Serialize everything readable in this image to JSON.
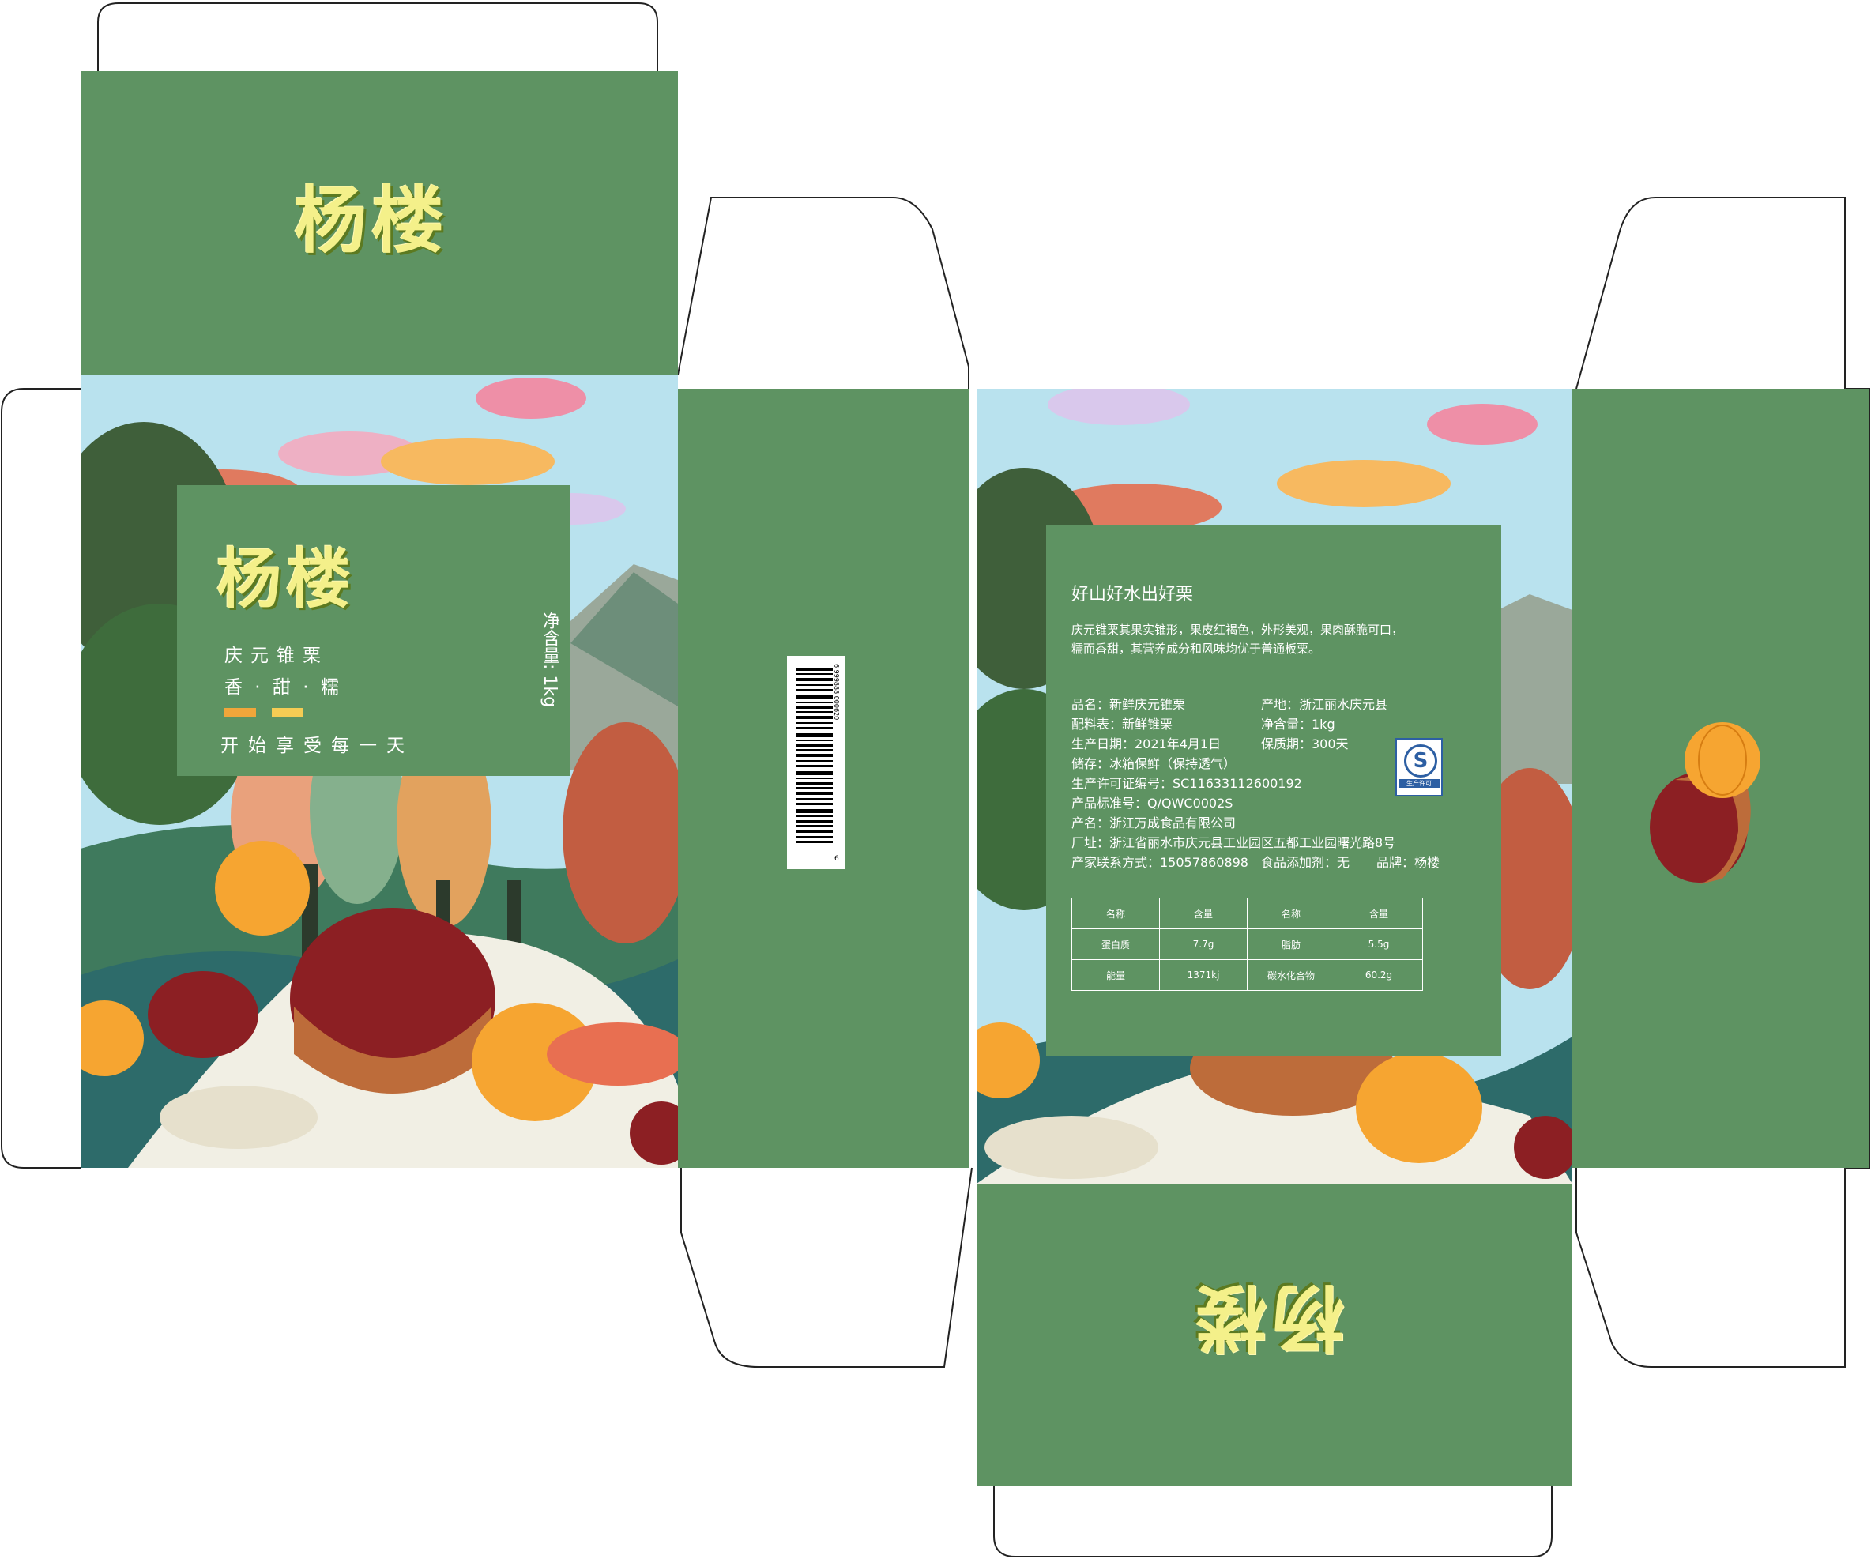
{
  "brand": {
    "name": "杨楼",
    "colors": {
      "panel_green": "#5e9362",
      "logo_yellow": "#f4f08a",
      "sky": "#b9e2ee"
    }
  },
  "front": {
    "product": "庆元锥栗",
    "taste": "香 · 甜 · 糯",
    "slogan": "开始享受每一天",
    "net_weight": "净含量: 1kg"
  },
  "side": {
    "barcode_number": "6 999888 000620",
    "barcode_digit": "6"
  },
  "back": {
    "headline": "好山好水出好栗",
    "description_line1": "庆元锥栗其果实锥形，果皮红褐色，外形美观，果肉酥脆可口，",
    "description_line2": "糯而香甜，其营养成分和风味均优于普通板栗。",
    "info": {
      "name": "品名：新鲜庆元锥栗",
      "origin": "产地：浙江丽水庆元县",
      "ingredients": "配料表：新鲜锥栗",
      "net": "净含量：1kg",
      "date": "生产日期：2021年4月1日",
      "shelf": "保质期：300天",
      "storage": "储存：冰箱保鲜（保持透气）",
      "license": "生产许可证编号：SC11633112600192",
      "standard": "产品标准号：Q/QWC0002S",
      "producer": "产名：浙江万成食品有限公司",
      "factory": "厂址：浙江省丽水市庆元县工业园区五都工业园曙光路8号",
      "contact": "产家联系方式：15057860898",
      "additive": "食品添加剂：无",
      "brand_line": "品牌：杨楼"
    },
    "qs_label": "生产许可",
    "nutrition": {
      "headers": [
        "名称",
        "含量",
        "名称",
        "含量"
      ],
      "rows": [
        [
          "蛋白质",
          "7.7g",
          "脂肪",
          "5.5g"
        ],
        [
          "能量",
          "1371kj",
          "碳水化合物",
          "60.2g"
        ]
      ]
    }
  }
}
